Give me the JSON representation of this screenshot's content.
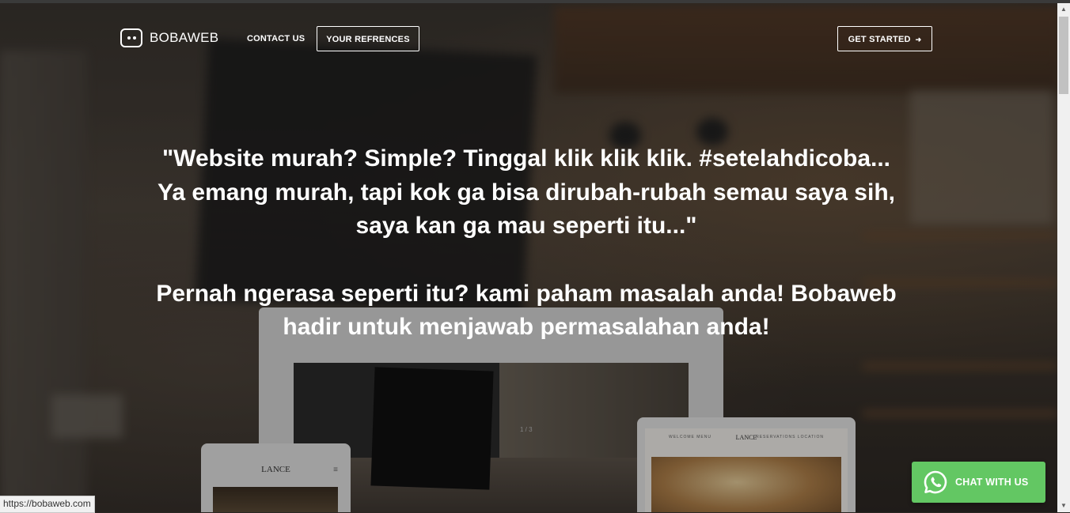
{
  "brand": {
    "name": "BOBAWEB",
    "icon": "robot-face-icon"
  },
  "nav": {
    "contact_label": "CONTACT US",
    "references_label": "YOUR REFRENCES",
    "get_started_label": "GET STARTED",
    "get_started_arrow": "➜"
  },
  "hero": {
    "line1": "\"Website murah? Simple? Tinggal klik klik klik. #setelahdicoba...",
    "line2": "Ya emang murah, tapi kok ga bisa dirubah-rubah semau saya sih,",
    "line3": "saya kan ga mau seperti itu...\"",
    "line4": "Pernah ngerasa seperti itu? kami paham masalah anda! Bobaweb",
    "line5": "hadir untuk menjawab permasalahan anda!"
  },
  "mockup": {
    "laptop_pager": "1 / 3",
    "phone_title": "LANCE",
    "phone_menu_icon": "≡",
    "tablet_title": "LANCE",
    "tablet_nav_left": "WELCOME  MENU",
    "tablet_nav_right": "RESERVATIONS  LOCATION"
  },
  "chat": {
    "label": "CHAT WITH US",
    "icon": "whatsapp-icon",
    "color": "#63c763"
  },
  "status_bar": {
    "url": "https://bobaweb.com"
  },
  "scrollbar": {
    "up_arrow": "▲",
    "down_arrow": "▼"
  }
}
